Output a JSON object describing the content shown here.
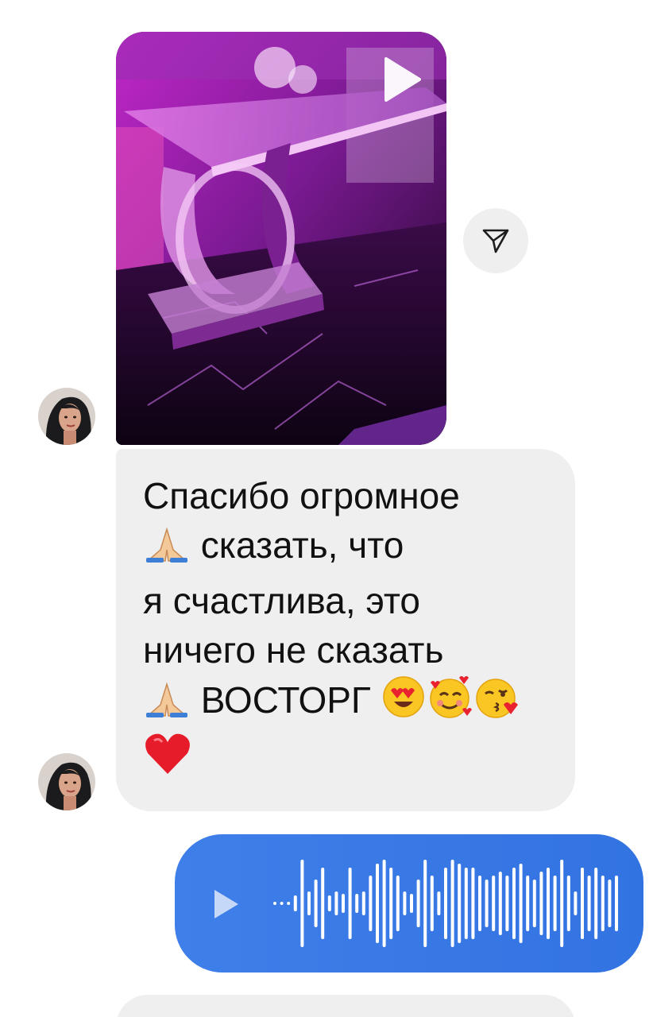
{
  "thread": {
    "incoming_message": {
      "lines": [
        "Спасибо огромное",
        " сказать, что",
        "я счастлива, это",
        "ничего не сказать",
        " ВОСТОРГ "
      ],
      "emoji_icons": [
        "folded-hands-icon",
        "folded-hands-icon",
        "heart-eyes-icon",
        "smiling-hearts-icon",
        "kissing-heart-icon",
        "red-heart-icon"
      ]
    },
    "shared_video": {
      "icon": "play-icon"
    },
    "share_button": {
      "icon": "paper-plane-icon"
    },
    "voice_message": {
      "icon": "play-icon",
      "bubble_color": "#3b7de6"
    }
  },
  "colors": {
    "incoming_bubble": "#efefef",
    "outgoing_bubble": "#3b7de6",
    "text": "#111111"
  }
}
